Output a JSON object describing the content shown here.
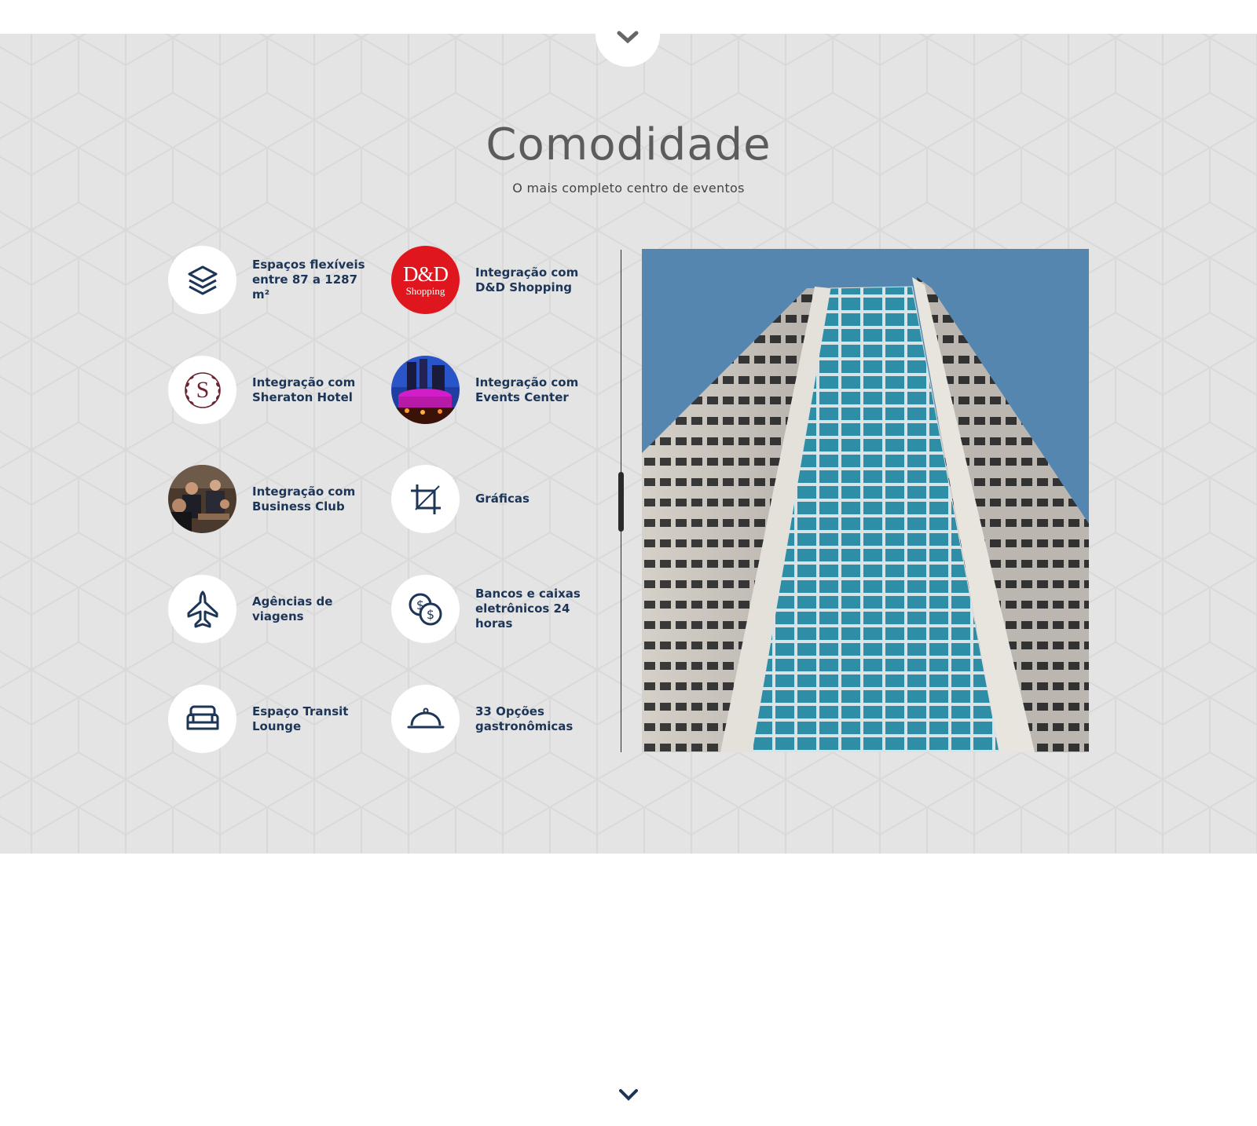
{
  "section": {
    "title": "Comodidade",
    "subtitle": "O mais completo centro de eventos"
  },
  "features": [
    {
      "icon": "layers-icon",
      "line1": "Espaços flexíveis",
      "line2": "entre 87 a 1287 m²"
    },
    {
      "icon": "dd-shopping-logo",
      "logo_text": "D&D",
      "logo_sub": "Shopping",
      "line1": "Integração com",
      "line2": "D&D Shopping"
    },
    {
      "icon": "sheraton-logo",
      "logo_text": "S",
      "line1": "Integração com",
      "line2": "Sheraton Hotel"
    },
    {
      "icon": "events-center-photo",
      "line1": "Integração com",
      "line2": "Events Center"
    },
    {
      "icon": "business-club-photo",
      "line1": "Integração com",
      "line2": "Business Club"
    },
    {
      "icon": "crop-icon",
      "line1": "Gráficas",
      "line2": ""
    },
    {
      "icon": "airplane-icon",
      "line1": "Agências de",
      "line2": "viagens"
    },
    {
      "icon": "coins-icon",
      "line1": "Bancos e caixas",
      "line2": "eletrônicos 24 horas"
    },
    {
      "icon": "sofa-icon",
      "line1": "Espaço Transit",
      "line2": "Lounge"
    },
    {
      "icon": "food-cloche-icon",
      "line1": "33 Opções",
      "line2": "gastronômicas"
    }
  ],
  "colors": {
    "accent": "#1d3557",
    "band_background": "#e4e4e4",
    "dd_red": "#e0161e",
    "sheraton": "#6b2430",
    "sky": "#5586b0"
  }
}
